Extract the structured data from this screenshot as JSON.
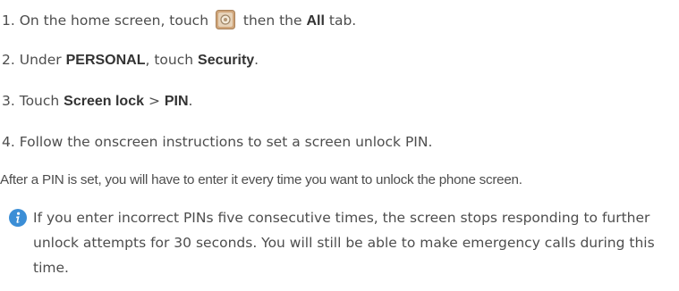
{
  "steps": [
    {
      "num": "1.",
      "pre": "On the home screen, touch",
      "icon": "settings-app-icon",
      "mid": "then the",
      "bold1": "All",
      "post": "tab."
    },
    {
      "num": "2.",
      "pre": "Under",
      "bold1": "PERSONAL",
      "mid": ", touch",
      "bold2": "Security",
      "post": "."
    },
    {
      "num": "3.",
      "pre": "Touch",
      "bold1": "Screen lock",
      "mid": ">",
      "bold2": "PIN",
      "post": "."
    },
    {
      "num": "4.",
      "text": "Follow the onscreen instructions to set a screen unlock PIN."
    }
  ],
  "paragraph": "After a PIN is set, you will have to enter it every time you want to unlock the phone screen.",
  "note": {
    "icon": "info-icon",
    "text": "If you enter incorrect PINs five consecutive times, the screen stops responding to further unlock attempts for 30 seconds. You will still be able to make emergency calls during this time."
  },
  "colors": {
    "text": "#4d4d4d",
    "info_icon_bg": "#3b8ed6",
    "settings_icon_bg": "#c9a27a"
  }
}
